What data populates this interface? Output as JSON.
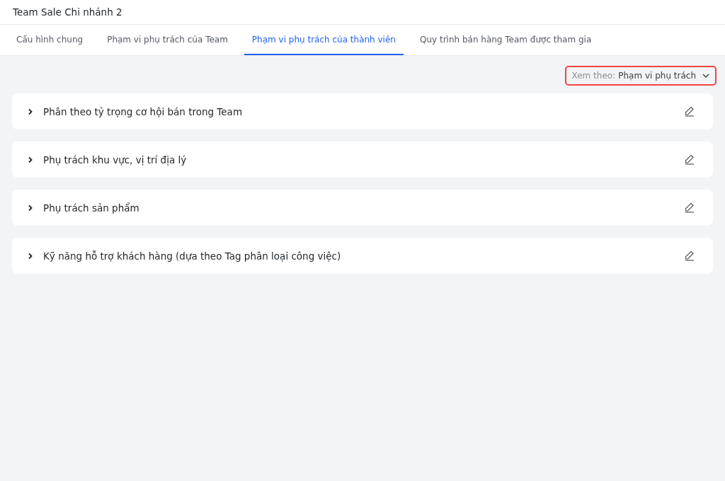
{
  "header": {
    "title": "Team Sale Chi nhánh 2"
  },
  "tabs": [
    {
      "label": "Cấu hình chung",
      "selected": false
    },
    {
      "label": "Phạm vi phụ trách của Team",
      "selected": false
    },
    {
      "label": "Phạm vi phụ trách của thành viên",
      "selected": true
    },
    {
      "label": "Quy trình bán hàng Team được tham gia",
      "selected": false
    }
  ],
  "view_selector": {
    "label": "Xem theo:",
    "value": "Phạm vi phụ trách",
    "highlighted": true
  },
  "sections": [
    {
      "title": "Phân theo tỷ trọng cơ hội bán trong Team",
      "expanded": false
    },
    {
      "title": "Phụ trách khu vực, vị trí địa lý",
      "expanded": false
    },
    {
      "title": "Phụ trách sản phẩm",
      "expanded": false
    },
    {
      "title": "Kỹ năng hỗ trợ khách hàng (dựa theo Tag phân loại công việc)",
      "expanded": false
    }
  ]
}
